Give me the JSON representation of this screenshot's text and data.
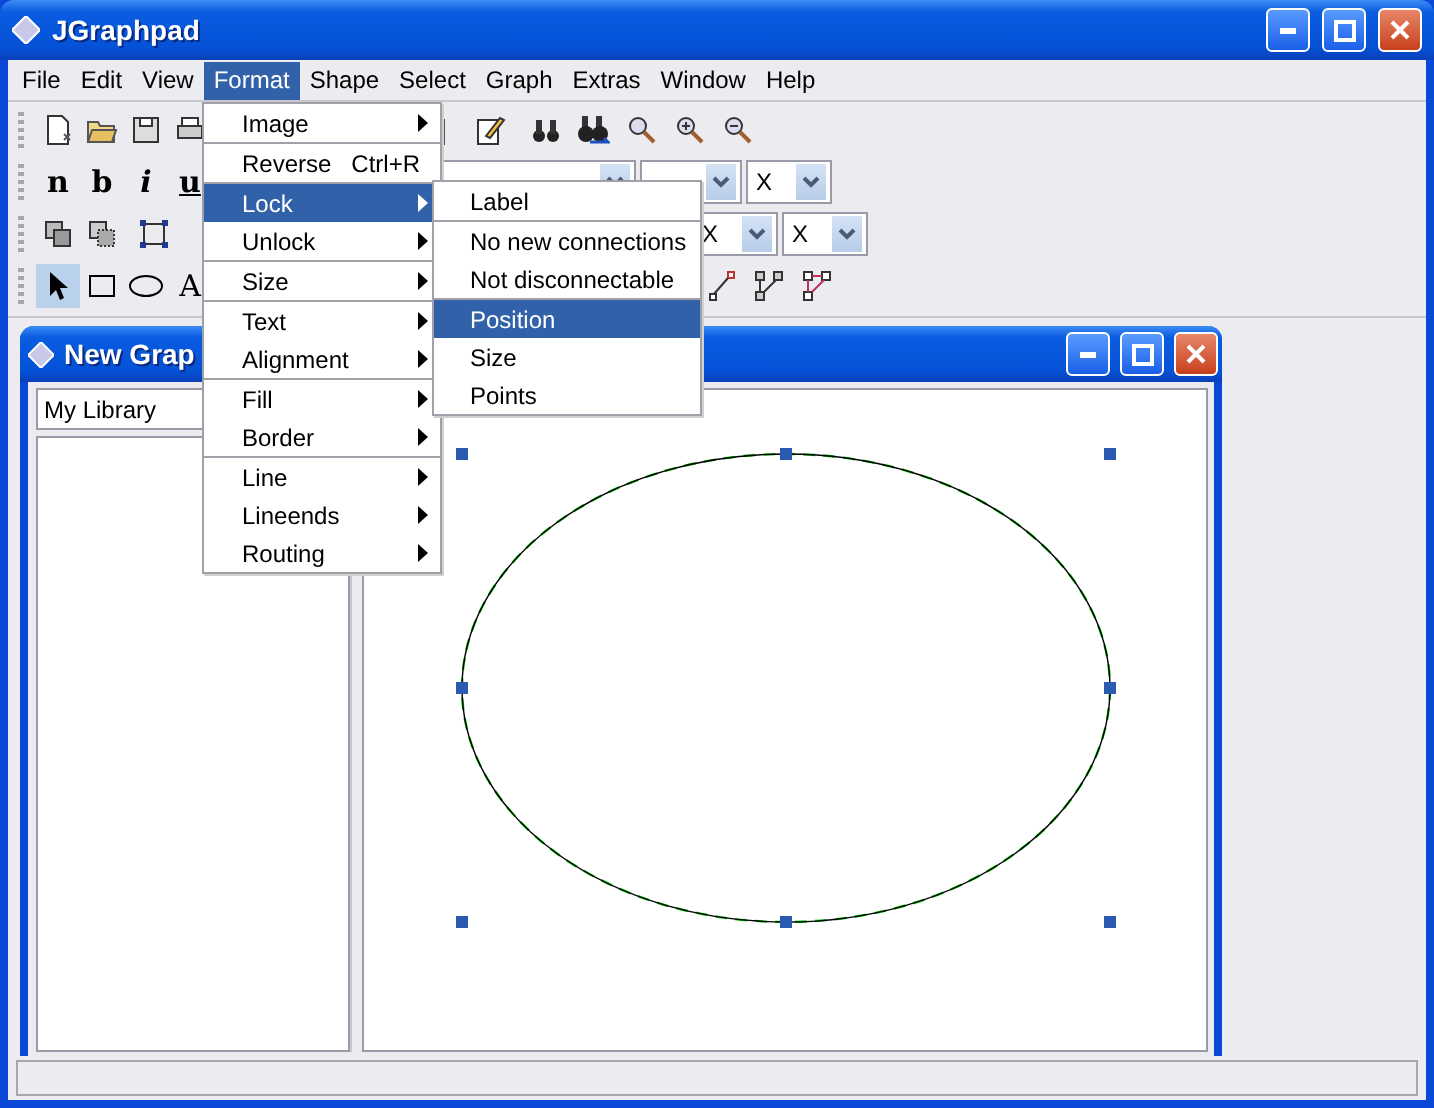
{
  "window": {
    "title": "JGraphpad"
  },
  "menubar": [
    {
      "label": "File",
      "selected": false
    },
    {
      "label": "Edit",
      "selected": false
    },
    {
      "label": "View",
      "selected": false
    },
    {
      "label": "Format",
      "selected": true
    },
    {
      "label": "Shape",
      "selected": false
    },
    {
      "label": "Select",
      "selected": false
    },
    {
      "label": "Graph",
      "selected": false
    },
    {
      "label": "Extras",
      "selected": false
    },
    {
      "label": "Window",
      "selected": false
    },
    {
      "label": "Help",
      "selected": false
    }
  ],
  "text_style_buttons": [
    "n",
    "b",
    "i",
    "u"
  ],
  "font_combos": [
    {
      "value": "X"
    }
  ],
  "line_combos": [
    {
      "value": "X"
    },
    {
      "value": "X"
    }
  ],
  "tools": [
    {
      "kind": "pointer",
      "selected": true
    },
    {
      "kind": "rectangle",
      "selected": false
    },
    {
      "kind": "ellipse",
      "selected": false
    },
    {
      "kind": "text",
      "label": "A",
      "selected": false
    }
  ],
  "format_menu": {
    "groups": [
      [
        {
          "label": "Image",
          "submenu": true,
          "selected": false
        }
      ],
      [
        {
          "label": "Reverse",
          "shortcut": "Ctrl+R",
          "submenu": false,
          "selected": false
        }
      ],
      [
        {
          "label": "Lock",
          "submenu": true,
          "selected": true
        },
        {
          "label": "Unlock",
          "submenu": true,
          "selected": false
        }
      ],
      [
        {
          "label": "Size",
          "submenu": true,
          "selected": false
        }
      ],
      [
        {
          "label": "Text",
          "submenu": true,
          "selected": false
        },
        {
          "label": "Alignment",
          "submenu": true,
          "selected": false
        }
      ],
      [
        {
          "label": "Fill",
          "submenu": true,
          "selected": false
        },
        {
          "label": "Border",
          "submenu": true,
          "selected": false
        }
      ],
      [
        {
          "label": "Line",
          "submenu": true,
          "selected": false
        },
        {
          "label": "Lineends",
          "submenu": true,
          "selected": false
        },
        {
          "label": "Routing",
          "submenu": true,
          "selected": false
        }
      ]
    ]
  },
  "lock_submenu": {
    "groups": [
      [
        {
          "label": "Label",
          "selected": false
        }
      ],
      [
        {
          "label": "No new connections",
          "selected": false
        },
        {
          "label": "Not disconnectable",
          "selected": false
        }
      ],
      [
        {
          "label": "Position",
          "selected": true
        },
        {
          "label": "Size",
          "selected": false
        },
        {
          "label": "Points",
          "selected": false
        }
      ]
    ]
  },
  "graph_window": {
    "title": "New Grap",
    "library": "My Library",
    "shape": {
      "kind": "ellipse",
      "selected": true
    }
  }
}
